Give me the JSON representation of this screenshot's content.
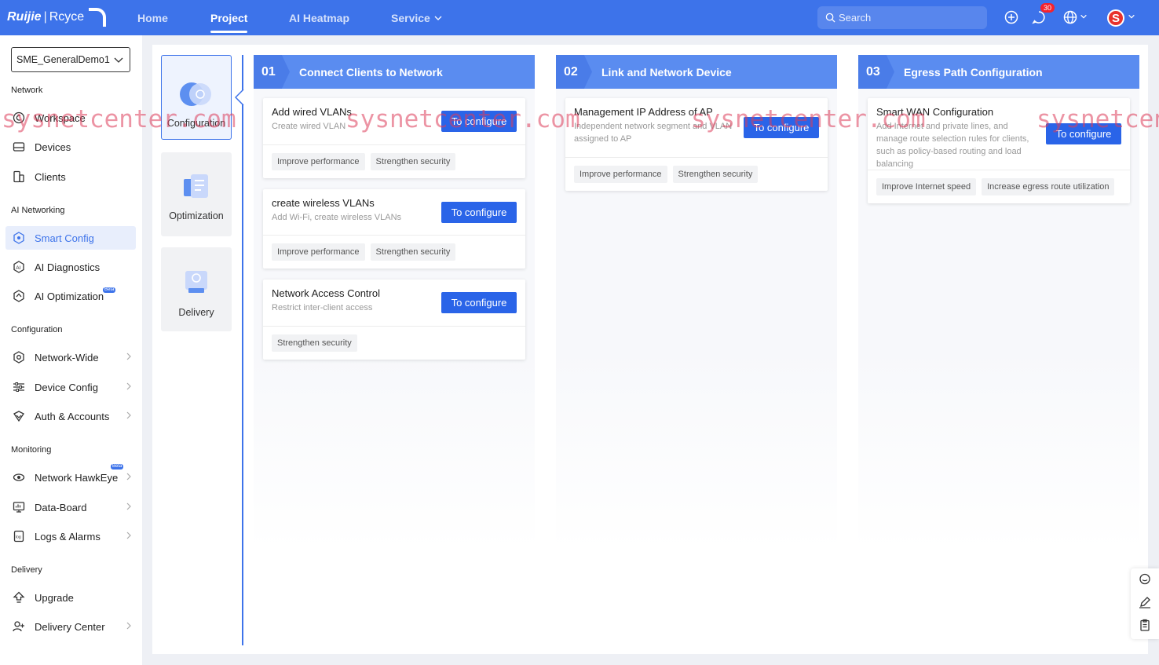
{
  "brand": {
    "logo_text": "Ruijie",
    "logo_sub": "Rcyce"
  },
  "top_nav": [
    {
      "label": "Home"
    },
    {
      "label": "Project"
    },
    {
      "label": "AI Heatmap"
    },
    {
      "label": "Service"
    }
  ],
  "search": {
    "placeholder": "Search"
  },
  "notifications": {
    "count": "30"
  },
  "user": {
    "avatar_letter": "S"
  },
  "sidebar": {
    "project": "SME_GeneralDemo1",
    "sections": {
      "network": "Network",
      "ai_networking": "AI Networking",
      "configuration": "Configuration",
      "monitoring": "Monitoring",
      "delivery": "Delivery"
    },
    "items": {
      "workspace": "Workspace",
      "devices": "Devices",
      "clients": "Clients",
      "smart_config": "Smart Config",
      "ai_diagnostics": "AI Diagnostics",
      "ai_optimization": "AI Optimization",
      "network_wide": "Network-Wide",
      "device_config": "Device Config",
      "auth_accounts": "Auth & Accounts",
      "network_hawkeye": "Network HawkEye",
      "data_board": "Data-Board",
      "logs_alarms": "Logs & Alarms",
      "upgrade": "Upgrade",
      "delivery_center": "Delivery Center"
    },
    "beta_label": "Beta"
  },
  "steps": {
    "configuration": "Configuration",
    "optimization": "Optimization",
    "delivery": "Delivery"
  },
  "columns": [
    {
      "num": "01",
      "title": "Connect Clients to Network",
      "cards": [
        {
          "title": "Add wired VLANs",
          "desc": "Create wired VLAN",
          "button": "To configure",
          "tags": [
            "Improve performance",
            "Strengthen security"
          ]
        },
        {
          "title": "create wireless VLANs",
          "desc": "Add Wi-Fi, create wireless VLANs",
          "button": "To configure",
          "tags": [
            "Improve performance",
            "Strengthen security"
          ]
        },
        {
          "title": "Network Access Control",
          "desc": "Restrict inter-client access",
          "button": "To configure",
          "tags": [
            "Strengthen security"
          ]
        }
      ]
    },
    {
      "num": "02",
      "title": "Link and Network Device",
      "cards": [
        {
          "title": "Management IP Address of AP",
          "desc": "Independent network segment and VLAN assigned to AP",
          "button": "To configure",
          "tags": [
            "Improve performance",
            "Strengthen security"
          ]
        }
      ]
    },
    {
      "num": "03",
      "title": "Egress Path Configuration",
      "cards": [
        {
          "title": "Smart WAN Configuration",
          "desc": "Add Internet and private lines, and manage route selection rules for clients, such as policy-based routing and load balancing",
          "button": "To configure",
          "tags": [
            "Improve Internet speed",
            "Increase egress route utilization"
          ]
        }
      ]
    }
  ],
  "watermark": "sysnetcenter.com",
  "colors": {
    "primary": "#3d73ea",
    "button": "#2a64e8",
    "badge": "#f5222d"
  }
}
